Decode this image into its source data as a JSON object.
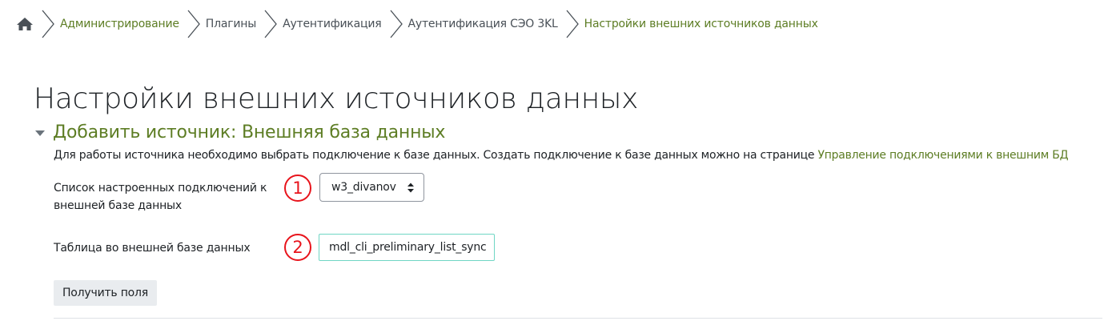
{
  "breadcrumb": {
    "home_icon": "home-icon",
    "items": [
      {
        "label": "Администрирование",
        "link": true
      },
      {
        "label": "Плагины",
        "link": false
      },
      {
        "label": "Аутентификация",
        "link": false
      },
      {
        "label": "Аутентификация СЭО 3KL",
        "link": false
      },
      {
        "label": "Настройки внешних источников данных",
        "link": true
      }
    ]
  },
  "page": {
    "title": "Настройки внешних источников данных"
  },
  "section": {
    "title": "Добавить источник: Внешняя база данных",
    "description_text": "Для работы источника необходимо выбрать подключение к базе данных. Создать подключение к базе данных можно на странице ",
    "description_link": "Управление подключениями к внешним БД"
  },
  "form": {
    "connections_label": "Список настроенных подключений к внешней базе данных",
    "connections_badge": "1",
    "connections_selected": "w3_divanov",
    "table_label": "Таблица во внешней базе данных",
    "table_badge": "2",
    "table_value": "mdl_cli_preliminary_list_sync",
    "get_fields_label": "Получить поля"
  },
  "colors": {
    "link": "#5d7d24",
    "badge": "#e8141c",
    "input_focus_border": "#70d6c4"
  }
}
